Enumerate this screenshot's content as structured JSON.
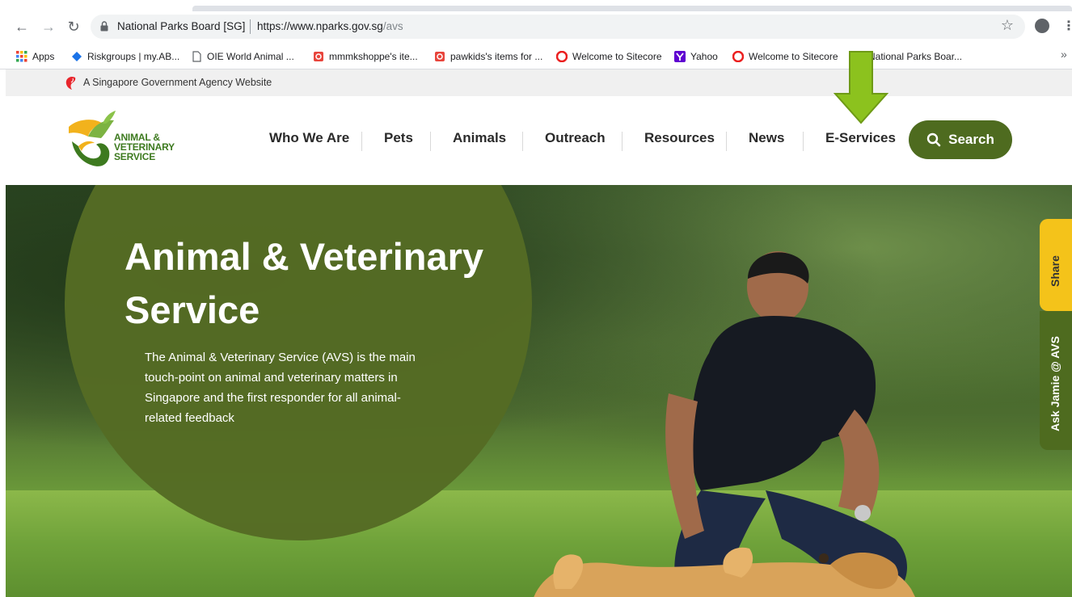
{
  "browser": {
    "site_name": "National Parks Board [SG]",
    "url_host": "https://www.nparks.gov.sg",
    "url_path": "/avs",
    "bookmarks": [
      {
        "label": "Apps",
        "icon": "apps-grid-icon"
      },
      {
        "label": "Riskgroups | my.AB...",
        "icon": "riskgroups-icon"
      },
      {
        "label": "OIE World Animal ...",
        "icon": "page-icon"
      },
      {
        "label": "mmmkshoppe's ite...",
        "icon": "shop-icon"
      },
      {
        "label": "pawkids's items for ...",
        "icon": "shop-icon"
      },
      {
        "label": "Welcome to Sitecore",
        "icon": "sitecore-icon"
      },
      {
        "label": "Yahoo",
        "icon": "yahoo-icon"
      },
      {
        "label": "Welcome to Sitecore",
        "icon": "sitecore-icon"
      },
      {
        "label": "National Parks Boar...",
        "icon": "nparks-icon"
      }
    ],
    "more_bookmarks": "»"
  },
  "gov_bar": {
    "text": "A Singapore Government Agency Website"
  },
  "header": {
    "logo_lines": [
      "ANIMAL &",
      "VETERINARY",
      "SERVICE"
    ],
    "nav": [
      {
        "label": "Who We Are"
      },
      {
        "label": "Pets"
      },
      {
        "label": "Animals"
      },
      {
        "label": "Outreach"
      },
      {
        "label": "Resources"
      },
      {
        "label": "News"
      },
      {
        "label": "E-Services"
      }
    ],
    "search_label": "Search"
  },
  "hero": {
    "title": "Animal & Veterinary Service",
    "description": "The Animal & Veterinary Service (AVS) is the main touch-point on animal and veterinary matters in Singapore and the first responder for all animal-related feedback"
  },
  "side_tabs": {
    "share_label": "Share",
    "jamie_label": "Ask Jamie @ AVS"
  },
  "colors": {
    "brand_green": "#4e6b1f",
    "circle_green": "#556b24",
    "share_yellow": "#f4c31a",
    "arrow_green": "#8cc21e"
  }
}
